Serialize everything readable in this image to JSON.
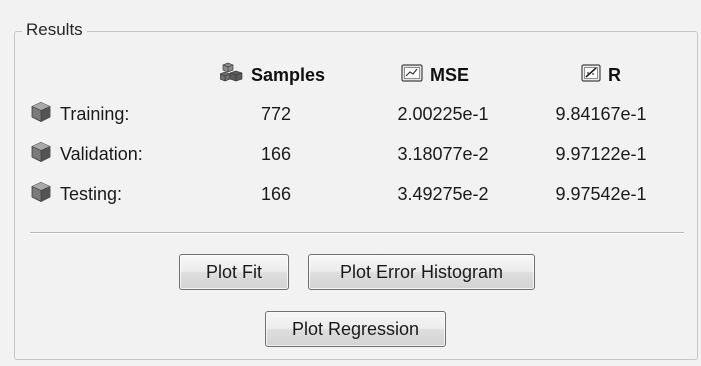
{
  "panel": {
    "title": "Results"
  },
  "columns": {
    "samples": "Samples",
    "mse": "MSE",
    "r": "R"
  },
  "rows": [
    {
      "label": "Training:",
      "samples": "772",
      "mse": "2.00225e-1",
      "r": "9.84167e-1"
    },
    {
      "label": "Validation:",
      "samples": "166",
      "mse": "3.18077e-2",
      "r": "9.97122e-1"
    },
    {
      "label": "Testing:",
      "samples": "166",
      "mse": "3.49275e-2",
      "r": "9.97542e-1"
    }
  ],
  "buttons": {
    "plot_fit": "Plot Fit",
    "plot_error_histogram": "Plot Error Histogram",
    "plot_regression": "Plot Regression"
  },
  "icons": {
    "samples": "cubes-stack-icon",
    "mse": "monitor-chart-icon",
    "r": "regression-icon",
    "row": "cube-icon"
  }
}
